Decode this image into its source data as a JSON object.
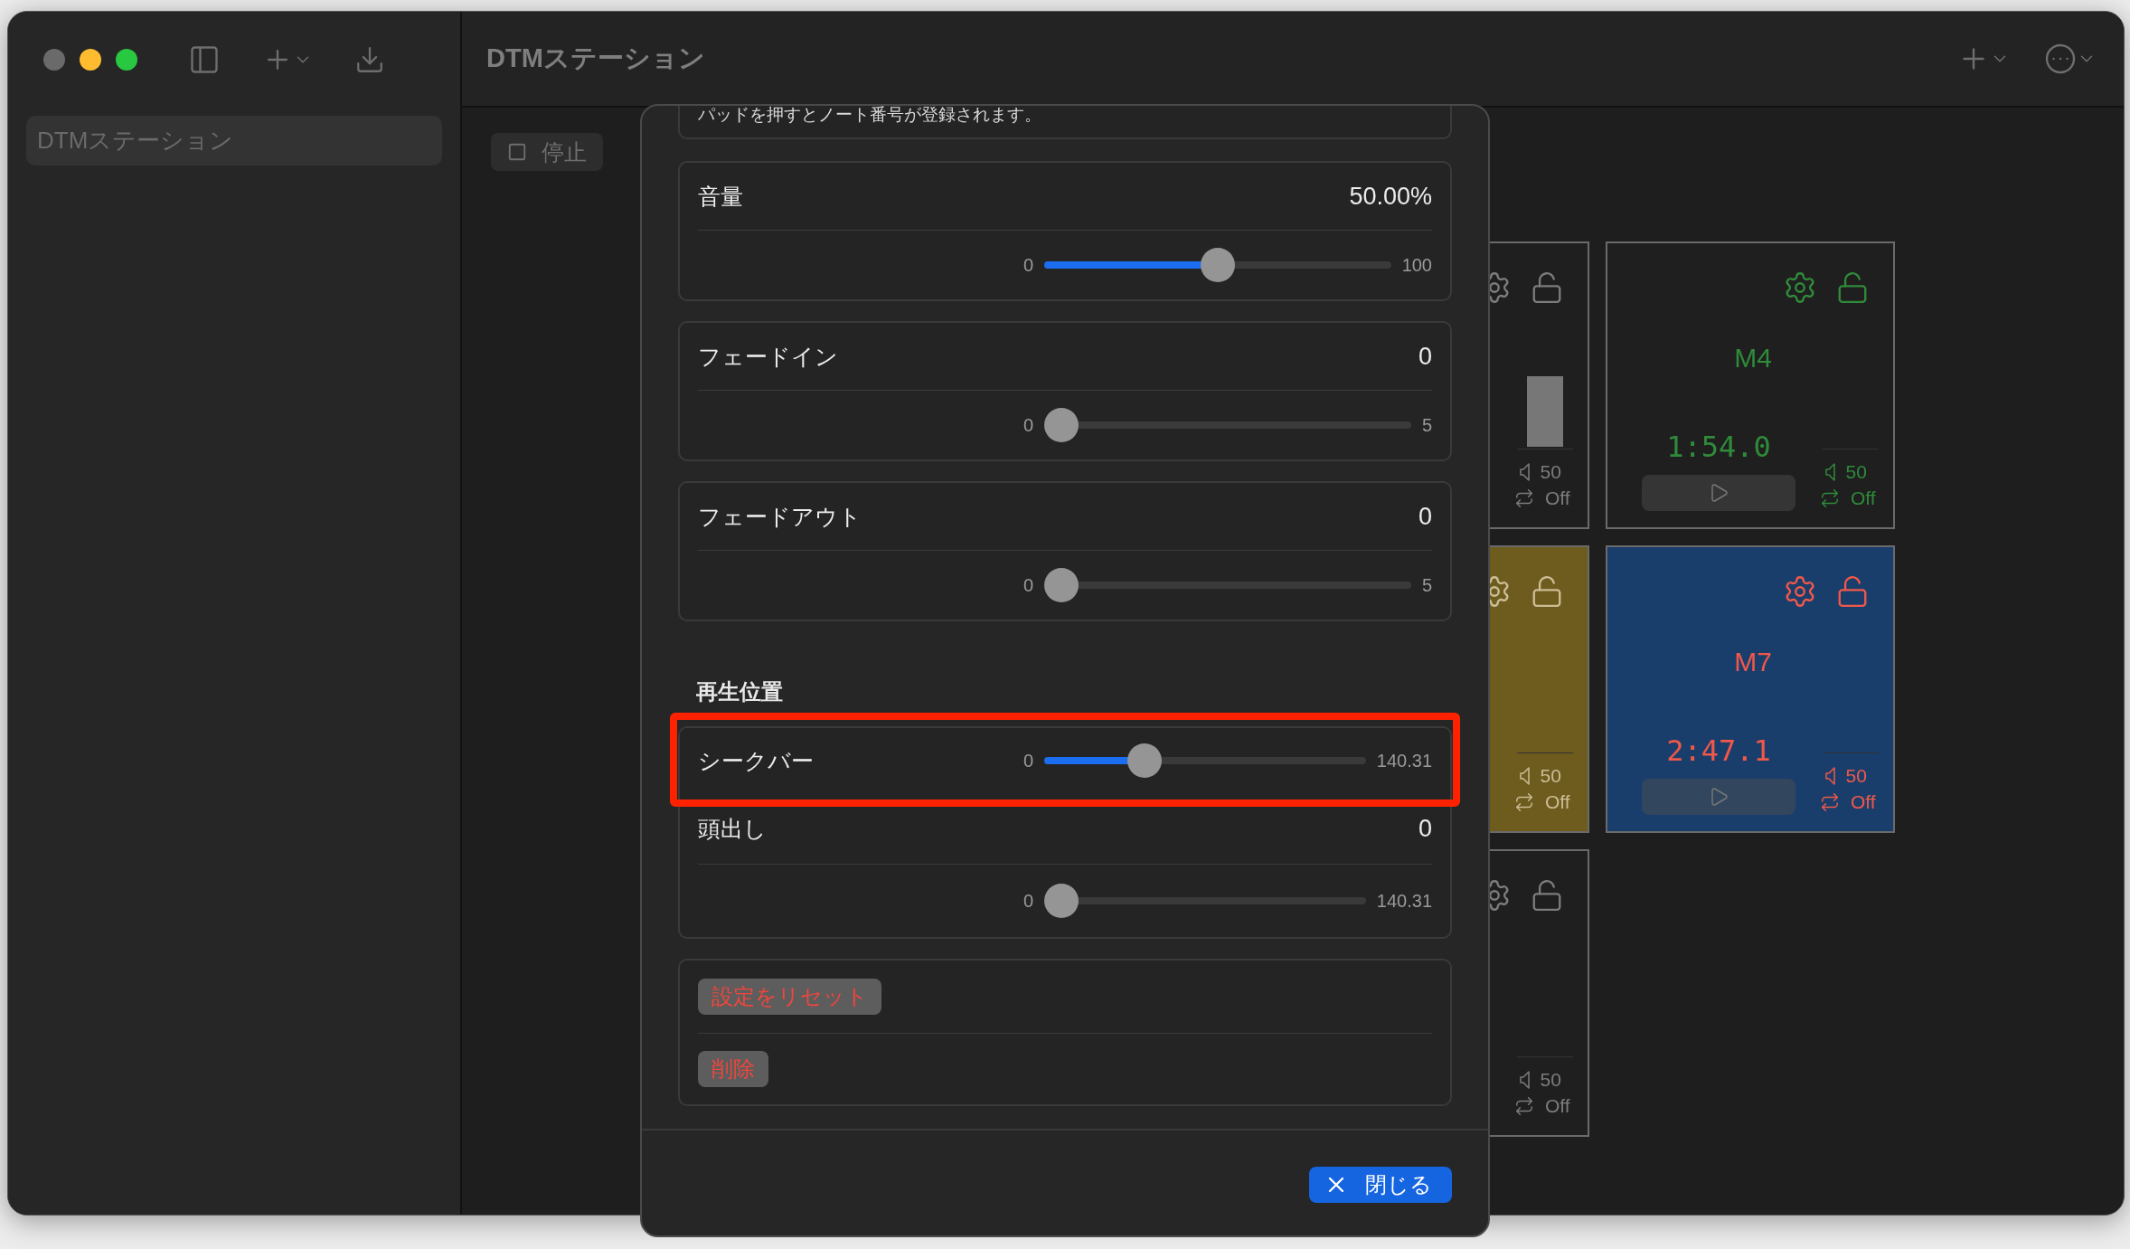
{
  "window": {
    "title": "DTMステーション"
  },
  "sidebar": {
    "items": [
      {
        "label": "DTMステーション",
        "selected": true
      }
    ]
  },
  "toolbar": {
    "buttons": [
      {
        "label": "停止"
      }
    ]
  },
  "pads": [
    {
      "kind": "meter",
      "color": "#1f1f1f",
      "ink": {
        "color": "#7c7c7c"
      },
      "volume": "50",
      "loop": "Off"
    },
    {
      "kind": "player",
      "name": "M4",
      "time": "1:54.0",
      "color": "#1f1f1f",
      "ink": {
        "color": "#2f8a3a"
      },
      "volume": "50",
      "loop": "Off"
    },
    {
      "kind": "stats",
      "color": "#6e5b1e",
      "ink": {
        "color": "#cbbd95"
      },
      "volume": "50",
      "loop": "Off"
    },
    {
      "kind": "player",
      "name": "M7",
      "time": "2:47.1",
      "color": "#1a3e6b",
      "ink": {
        "color": "#f0584a"
      },
      "volume": "50",
      "loop": "Off"
    },
    {
      "kind": "stats",
      "color": "#1f1f1f",
      "ink": {
        "color": "#7c7c7c"
      },
      "volume": "50",
      "loop": "Off"
    }
  ],
  "dialog": {
    "note": "パッドを押すとノート番号が登録されます。",
    "sliders": [
      {
        "label": "音量",
        "value": "50.00%",
        "min": "0",
        "max": "100",
        "level": 0.5
      },
      {
        "label": "フェードイン",
        "value": "0",
        "min": "0",
        "max": "5",
        "level": 0
      },
      {
        "label": "フェードアウト",
        "value": "0",
        "min": "0",
        "max": "5",
        "level": 0
      }
    ],
    "playback": {
      "heading": "再生位置",
      "seekbar": {
        "label": "シークバー",
        "min": "0",
        "max": "140.31",
        "level": 0.29,
        "highlighted": true
      },
      "cue": {
        "label": "頭出し",
        "value": "0",
        "min": "0",
        "max": "140.31",
        "level": 0
      }
    },
    "actions": [
      "設定をリセット",
      "削除"
    ],
    "close_button": "閉じる"
  }
}
